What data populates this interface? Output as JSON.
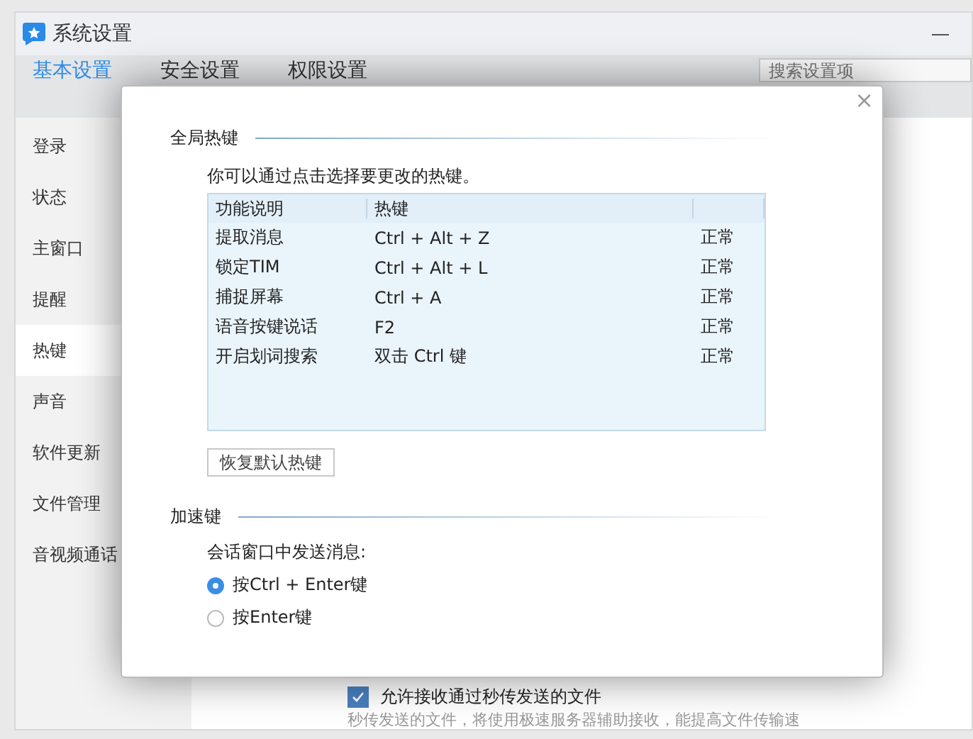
{
  "window": {
    "title": "系统设置"
  },
  "tabs": [
    {
      "label": "基本设置",
      "selected": true
    },
    {
      "label": "安全设置",
      "selected": false
    },
    {
      "label": "权限设置",
      "selected": false
    }
  ],
  "search": {
    "placeholder": "搜索设置项"
  },
  "sidebar": {
    "items": [
      {
        "label": "登录",
        "selected": false
      },
      {
        "label": "状态",
        "selected": false
      },
      {
        "label": "主窗口",
        "selected": false
      },
      {
        "label": "提醒",
        "selected": false
      },
      {
        "label": "热键",
        "selected": true
      },
      {
        "label": "声音",
        "selected": false
      },
      {
        "label": "软件更新",
        "selected": false
      },
      {
        "label": "文件管理",
        "selected": false
      },
      {
        "label": "音视频通话",
        "selected": false
      }
    ]
  },
  "background_content": {
    "checkbox": {
      "label": "允许接收通过秒传发送的文件",
      "checked": true
    },
    "hint": "秒传发送的文件，将使用极速服务器辅助接收，能提高文件传输速"
  },
  "dialog": {
    "close": "×",
    "global_hotkeys": {
      "title": "全局热键",
      "description": "你可以通过点击选择要更改的热键。",
      "table": {
        "columns": [
          "功能说明",
          "热键",
          ""
        ],
        "rows": [
          [
            "提取消息",
            "Ctrl + Alt + Z",
            "正常"
          ],
          [
            "锁定TIM",
            "Ctrl + Alt + L",
            "正常"
          ],
          [
            "捕捉屏幕",
            "Ctrl + A",
            "正常"
          ],
          [
            "语音按键说话",
            "F2",
            "正常"
          ],
          [
            "开启划词搜索",
            "双击 Ctrl 键",
            "正常"
          ]
        ]
      },
      "restore_button": "恢复默认热键"
    },
    "accelerator": {
      "title": "加速键",
      "prompt": "会话窗口中发送消息:",
      "options": [
        {
          "label": "按Ctrl + Enter键",
          "selected": true
        },
        {
          "label": "按Enter键",
          "selected": false
        }
      ]
    }
  }
}
